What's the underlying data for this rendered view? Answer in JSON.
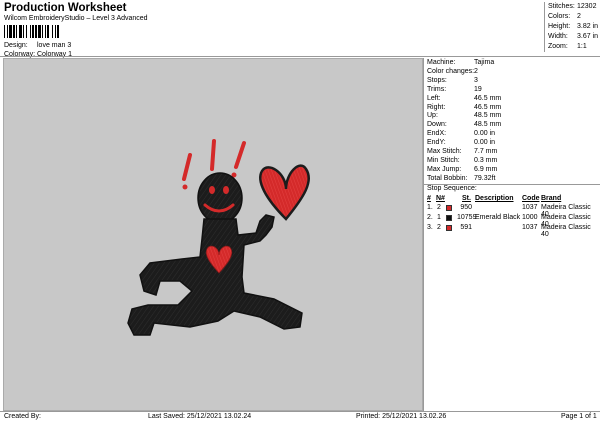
{
  "header": {
    "title": "Production Worksheet",
    "subtitle": "Wilcom EmbroideryStudio – Level 3 Advanced",
    "design_label": "Design:",
    "design_value": "love man 3",
    "colorway_label": "Colorway:",
    "colorway_value": "Colorway 1"
  },
  "summary": {
    "stitches_label": "Stitches:",
    "stitches_value": "12302",
    "colors_label": "Colors:",
    "colors_value": "2",
    "height_label": "Height:",
    "height_value": "3.82 in",
    "width_label": "Width:",
    "width_value": "3.67 in",
    "zoom_label": "Zoom:",
    "zoom_value": "1:1"
  },
  "properties": [
    {
      "label": "Machine:",
      "value": "Tajima"
    },
    {
      "label": "Color changes:",
      "value": "2"
    },
    {
      "label": "Stops:",
      "value": "3"
    },
    {
      "label": "Trims:",
      "value": "19"
    },
    {
      "label": "Left:",
      "value": "46.5 mm"
    },
    {
      "label": "Right:",
      "value": "46.5 mm"
    },
    {
      "label": "Up:",
      "value": "48.5 mm"
    },
    {
      "label": "Down:",
      "value": "48.5 mm"
    },
    {
      "label": "EndX:",
      "value": "0.00 in"
    },
    {
      "label": "EndY:",
      "value": "0.00 in"
    },
    {
      "label": "Max Stitch:",
      "value": "7.7 mm"
    },
    {
      "label": "Min Stitch:",
      "value": "0.3 mm"
    },
    {
      "label": "Max Jump:",
      "value": "6.9 mm"
    },
    {
      "label": "Total Bobbin:",
      "value": "79.32ft"
    }
  ],
  "stop_sequence": {
    "title": "Stop Sequence:",
    "headers": [
      "#",
      "N#",
      "St.",
      "Description",
      "Code",
      "Brand"
    ],
    "rows": [
      {
        "num": "1.",
        "needle": "2",
        "color": "#d42a2a",
        "stitches": "950",
        "description": "",
        "code": "1037",
        "brand": "Madeira Classic 40"
      },
      {
        "num": "2.",
        "needle": "1",
        "color": "#111111",
        "stitches": "10759",
        "description": "Emerald Black",
        "code": "1000",
        "brand": "Madeira Classic 40"
      },
      {
        "num": "3.",
        "needle": "2",
        "color": "#d42a2a",
        "stitches": "591",
        "description": "",
        "code": "1037",
        "brand": "Madeira Classic 40"
      }
    ]
  },
  "footer": {
    "created_by": "Created By:",
    "last_saved": "Last Saved: 25/12/2021 13.02.24",
    "printed": "Printed: 25/12/2021 13.02.26",
    "page": "Page 1 of 1"
  },
  "colors": {
    "canvas_bg": "#c8c8c8",
    "thread_black": "#1c1c1c",
    "thread_red": "#d42a2a"
  }
}
